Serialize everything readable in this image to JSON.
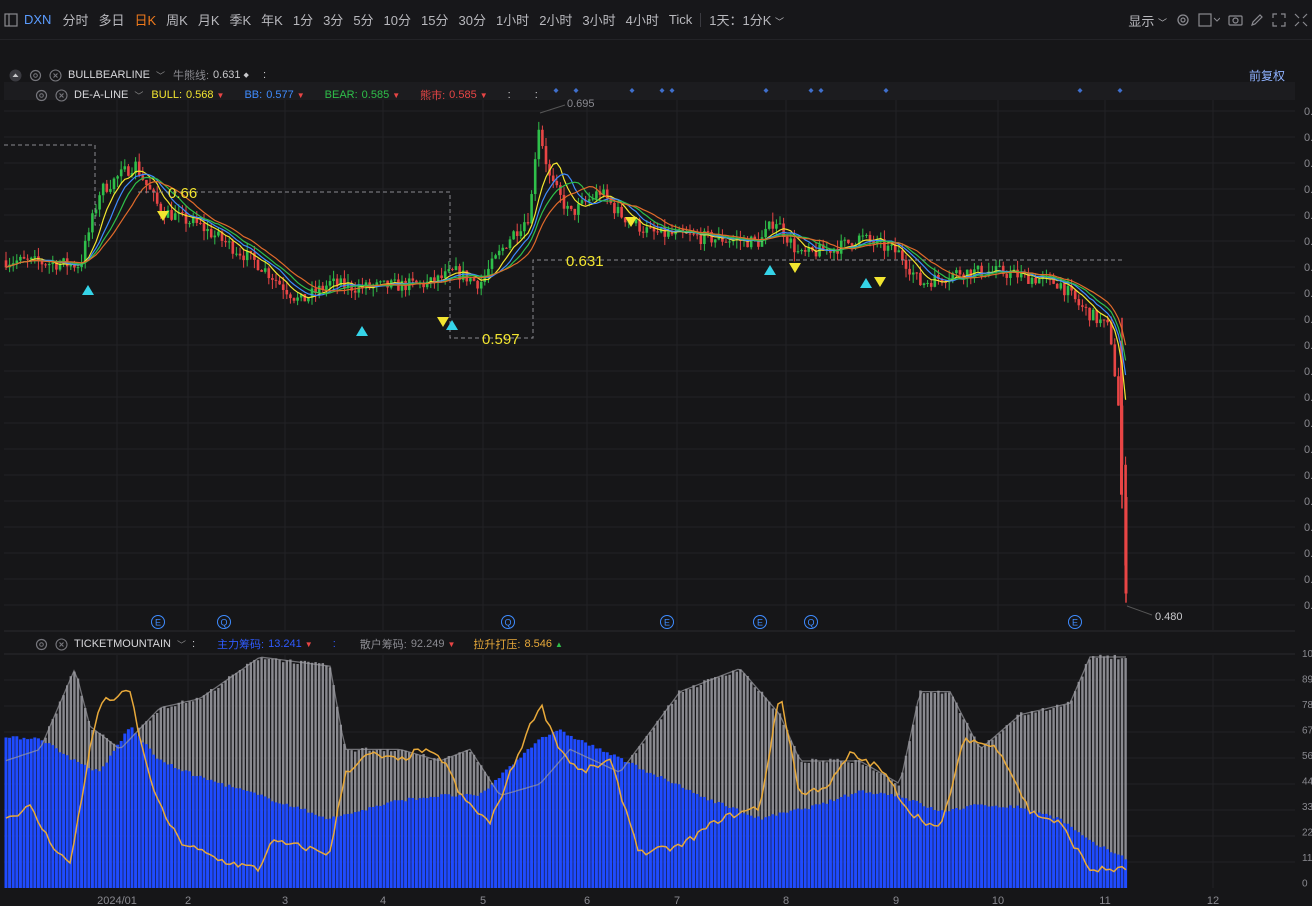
{
  "toolbar": {
    "symbol": "DXN",
    "periods": [
      "分时",
      "多日",
      "日K",
      "周K",
      "月K",
      "季K",
      "年K",
      "1分",
      "3分",
      "5分",
      "10分",
      "15分",
      "30分",
      "1小时",
      "2小时",
      "3小时",
      "4小时",
      "Tick"
    ],
    "active_period": "日K",
    "session": "1天：1分K",
    "display_label": "显示"
  },
  "indicator1": {
    "name": "BULLBEARLINE",
    "label": "牛熊线:",
    "value": "0.631"
  },
  "indicator2": {
    "name": "DE-A-LINE",
    "bull_label": "BULL:",
    "bull_value": "0.568",
    "bb_label": "BB:",
    "bb_value": "0.577",
    "bear_label": "BEAR:",
    "bear_value": "0.585",
    "xx_label": "熊市:",
    "xx_value": "0.585"
  },
  "restore_label": "前复权",
  "price_marks": {
    "high": "0.695",
    "low": "0.480",
    "level1": "0.66",
    "level2": "0.631",
    "level3": "0.597"
  },
  "indicator3": {
    "name": "TICKETMOUNTAIN",
    "main_label": "主力筹码:",
    "main_value": "13.241",
    "retail_label": "散户筹码:",
    "retail_value": "92.249",
    "lift_label": "拉升打压:",
    "lift_value": "8.546"
  },
  "x_axis_labels": [
    "2024/01",
    "2",
    "3",
    "4",
    "5",
    "6",
    "7",
    "8",
    "9",
    "10",
    "11",
    "12"
  ],
  "sub_axis_labels": [
    "10",
    "89",
    "78",
    "67",
    "56",
    "44",
    "33",
    "22",
    "11",
    "0"
  ],
  "colors": {
    "up": "#2fbf4a",
    "down": "#e84545",
    "bull": "#f2e530",
    "bb": "#3f8cff",
    "bear": "#2fbf4a",
    "bearish": "#e84545",
    "accent": "#f07a1c",
    "main": "#1f4bff",
    "retail": "#8a8a90",
    "lift": "#e8a93a"
  },
  "chart_data": {
    "type": "candlestick",
    "low_label": "0.480",
    "high_label": "0.695",
    "event_badges": [
      "E",
      "Q",
      "Q",
      "E",
      "E",
      "Q",
      "E"
    ]
  }
}
